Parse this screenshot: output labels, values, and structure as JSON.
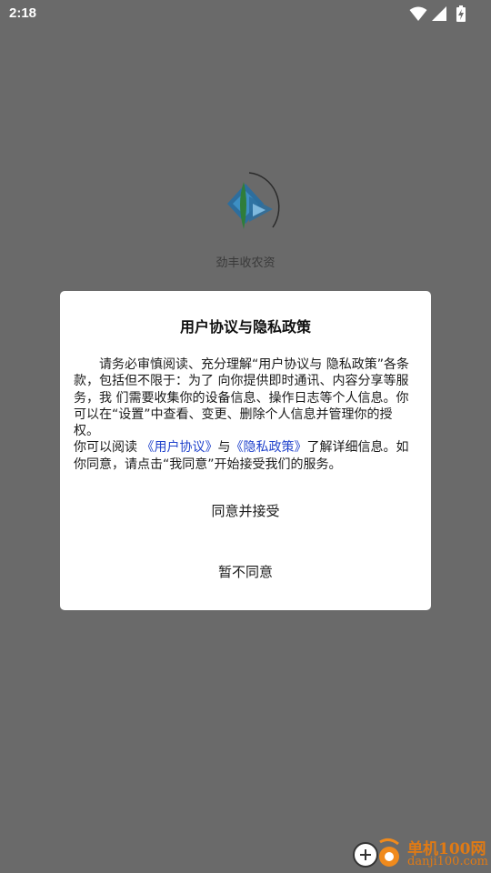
{
  "status_bar": {
    "time": "2:18",
    "icons": [
      "wifi-icon",
      "cell-signal-icon",
      "battery-charging-icon"
    ]
  },
  "app": {
    "name": "劲丰收农资",
    "logo_icon": "app-logo-icon"
  },
  "dialog": {
    "title": "用户协议与隐私政策",
    "body_paragraph_1": "请务必审慎阅读、充分理解“用户协议与 隐私政策”各条款，包括但不限于：为了 向你提供即时通讯、内容分享等服务，我 们需要收集你的设备信息、操作日志等个人信息。你可以在“设置”中查看、变更、删除个人信息并管理你的授权。",
    "body_paragraph_2_prefix": "你可以阅读",
    "user_agreement_link": "《用户协议》",
    "conjunction": "与",
    "privacy_policy_link": "《隐私政策》",
    "body_paragraph_2_suffix": "了解详细信息。如你同意，请点击“我同意”开始接受我们的服务。",
    "accept_button": "同意并接受",
    "decline_button": "暂不同意"
  },
  "watermark": {
    "text_cn": "单机100网",
    "text_en": "danji100.com"
  },
  "colors": {
    "overlay": "#6a6a6a",
    "dialog_bg": "#ffffff",
    "link": "#2244cc",
    "watermark": "#e07a14"
  }
}
